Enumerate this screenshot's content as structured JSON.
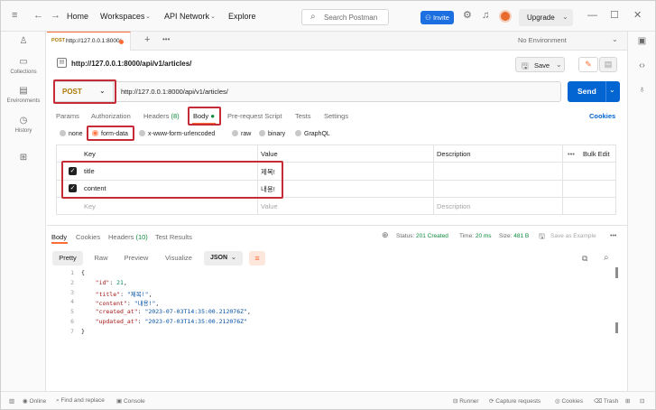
{
  "topbar": {
    "home": "Home",
    "workspaces": "Workspaces",
    "api_network": "API Network",
    "explore": "Explore",
    "search_placeholder": "Search Postman",
    "invite": "Invite",
    "upgrade": "Upgrade"
  },
  "sidebar": {
    "items": [
      {
        "label": "",
        "icon": "user-icon"
      },
      {
        "label": "Collections",
        "icon": "collections-icon"
      },
      {
        "label": "Environments",
        "icon": "environments-icon"
      },
      {
        "label": "History",
        "icon": "history-icon"
      },
      {
        "label": "",
        "icon": "grid-icon"
      }
    ]
  },
  "tab": {
    "method": "POST",
    "url": "http://127.0.0.1:8000/",
    "environment": "No Environment"
  },
  "request": {
    "title": "http://127.0.0.1:8000/api/v1/articles/",
    "save": "Save",
    "method": "POST",
    "url": "http://127.0.0.1:8000/api/v1/articles/",
    "send": "Send",
    "tabs": {
      "params": "Params",
      "authorization": "Authorization",
      "headers": "Headers",
      "headers_count": "(8)",
      "body": "Body",
      "prerequest": "Pre-request Script",
      "tests": "Tests",
      "settings": "Settings"
    },
    "cookies": "Cookies",
    "body_types": [
      "none",
      "form-data",
      "x-www-form-urlencoded",
      "raw",
      "binary",
      "GraphQL"
    ],
    "table": {
      "headers": {
        "key": "Key",
        "value": "Value",
        "description": "Description",
        "bulk_edit": "Bulk Edit",
        "more": "•••"
      },
      "rows": [
        {
          "key": "title",
          "value": "제목!",
          "checked": true
        },
        {
          "key": "content",
          "value": "내용!",
          "checked": true
        }
      ],
      "placeholder": {
        "key": "Key",
        "value": "Value",
        "description": "Description"
      }
    }
  },
  "response": {
    "tabs": {
      "body": "Body",
      "cookies": "Cookies",
      "headers": "Headers",
      "headers_count": "(10)",
      "test_results": "Test Results"
    },
    "status_label": "Status:",
    "status_value": "201 Created",
    "time_label": "Time:",
    "time_value": "20 ms",
    "size_label": "Size:",
    "size_value": "481 B",
    "save_example": "Save as Example",
    "more": "•••",
    "formats": {
      "pretty": "Pretty",
      "raw": "Raw",
      "preview": "Preview",
      "visualize": "Visualize",
      "json": "JSON"
    },
    "lines": {
      "n1": "1",
      "n2": "2",
      "n3": "3",
      "n4": "4",
      "n5": "5",
      "n6": "6",
      "n7": "7",
      "open": "{",
      "close": "}",
      "id_key": "\"id\"",
      "id_val": "21",
      "title_key": "\"title\"",
      "title_val": "\"제목!\"",
      "content_key": "\"content\"",
      "content_val": "\"내용!\"",
      "created_key": "\"created_at\"",
      "created_val": "\"2023-07-03T14:35:00.212076Z\"",
      "updated_key": "\"updated_at\"",
      "updated_val": "\"2023-07-03T14:35:00.212076Z\""
    }
  },
  "footer": {
    "online": "Online",
    "find_replace": "Find and replace",
    "console": "Console",
    "runner": "Runner",
    "capture": "Capture requests",
    "cookies": "Cookies",
    "trash": "Trash"
  },
  "colors": {
    "accent": "#ff6c37",
    "send": "#0265d2",
    "highlight": "#c62b38",
    "post": "#ad7a03",
    "status_ok": "#0c8a3c"
  }
}
